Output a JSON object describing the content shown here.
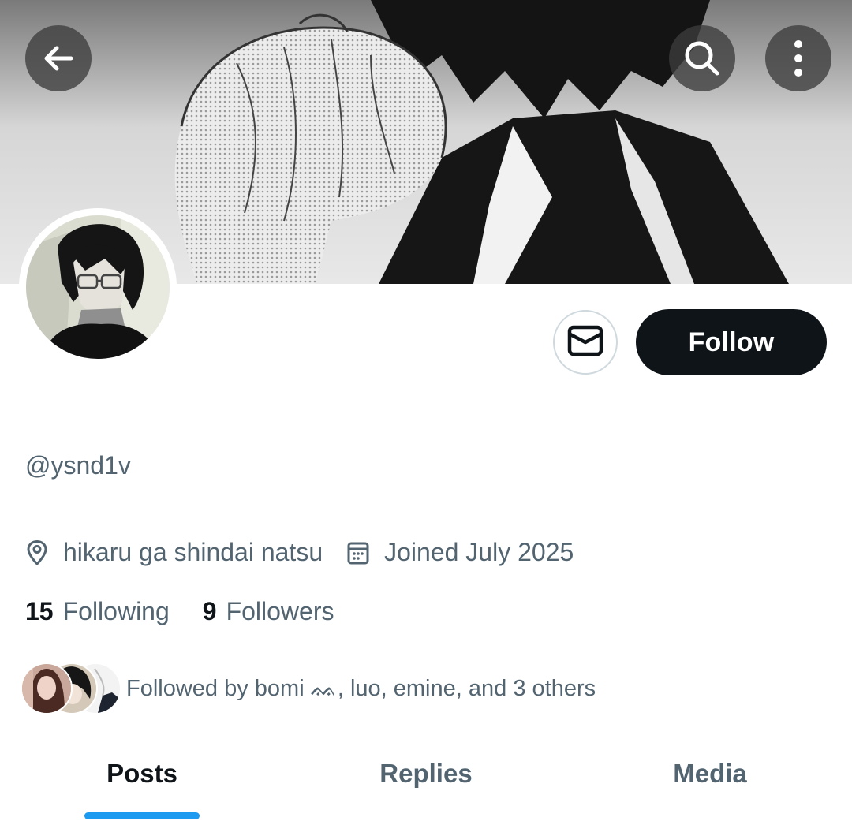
{
  "header": {
    "back_icon": "arrow-left-icon",
    "search_icon": "search-icon",
    "more_icon": "more-vertical-icon"
  },
  "profile": {
    "handle": "@ysnd1v",
    "location": "hikaru ga shindai natsu",
    "joined": "Joined July 2025",
    "following_count": "15",
    "following_label": "Following",
    "followers_count": "9",
    "followers_label": "Followers",
    "followed_by": "Followed by bomi ᨐ, luo, emine, and 3 others"
  },
  "actions": {
    "message_icon": "envelope-icon",
    "follow_label": "Follow"
  },
  "tabs": [
    {
      "label": "Posts",
      "active": true
    },
    {
      "label": "Replies",
      "active": false
    },
    {
      "label": "Media",
      "active": false
    }
  ],
  "colors": {
    "accent": "#1d9bf0",
    "primary_text": "#0f1419",
    "secondary_text": "#536471",
    "button_dark": "#0f1419"
  }
}
